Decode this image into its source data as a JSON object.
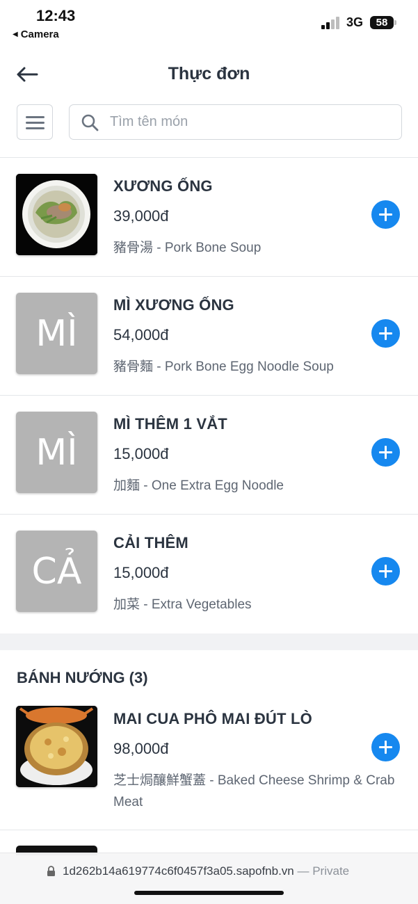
{
  "status_bar": {
    "time": "12:43",
    "back_app": "Camera",
    "network": "3G",
    "battery": "58"
  },
  "header": {
    "title": "Thực đơn",
    "back_icon": "arrow-left-icon",
    "menu_icon": "hamburger-icon"
  },
  "search": {
    "placeholder": "Tìm tên món",
    "value": "",
    "icon": "search-icon"
  },
  "items": [
    {
      "name": "XƯƠNG ỐNG",
      "price": "39,000đ",
      "description": "豬骨湯 - Pork Bone Soup",
      "thumb_text": "",
      "thumb": "photo-soup-bowl"
    },
    {
      "name": "MÌ XƯƠNG ỐNG",
      "price": "54,000đ",
      "description": "豬骨麵 - Pork Bone Egg Noodle Soup",
      "thumb_text": "MÌ",
      "thumb": "placeholder"
    },
    {
      "name": "MÌ THÊM 1 VẮT",
      "price": "15,000đ",
      "description": "加麵 - One Extra Egg Noodle",
      "thumb_text": "MÌ",
      "thumb": "placeholder"
    },
    {
      "name": "CẢI THÊM",
      "price": "15,000đ",
      "description": "加菜 - Extra Vegetables",
      "thumb_text": "CẢ",
      "thumb": "placeholder"
    }
  ],
  "section": {
    "title": "BÁNH NƯỚNG (3)",
    "items": [
      {
        "name": "MAI CUA PHÔ MAI ĐÚT LÒ",
        "price": "98,000đ",
        "description": "芝士焗釀鮮蟹蓋 - Baked Cheese Shrimp & Crab Meat",
        "thumb": "photo-baked-crab"
      }
    ]
  },
  "url_bar": {
    "url": "1d262b14a619774c6f0457f3a05.sapofnb.vn",
    "mode": "— Private"
  },
  "colors": {
    "accent": "#1688ef",
    "text": "#2b3440",
    "muted": "#5e6672",
    "placeholder_thumb": "#b4b4b4"
  }
}
